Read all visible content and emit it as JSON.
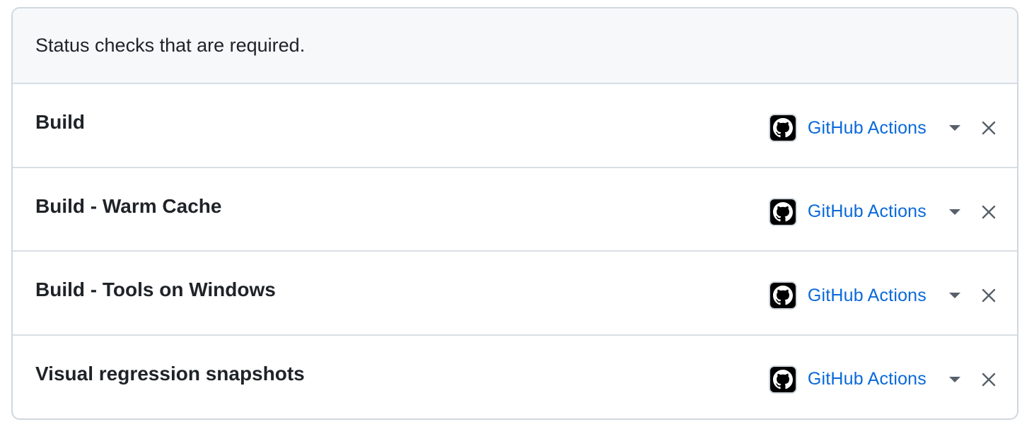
{
  "header": {
    "text": "Status checks that are required."
  },
  "checks": [
    {
      "name": "Build",
      "app_name": "GitHub Actions"
    },
    {
      "name": "Build - Warm Cache",
      "app_name": "GitHub Actions"
    },
    {
      "name": "Build - Tools on Windows",
      "app_name": "GitHub Actions"
    },
    {
      "name": "Visual regression snapshots",
      "app_name": "GitHub Actions"
    }
  ],
  "icons": {
    "app_avatar": "github-octocat-icon",
    "dropdown": "triangle-down-icon",
    "remove": "x-icon"
  },
  "colors": {
    "link": "#0969da",
    "header_bg": "#f6f8fa",
    "border": "#d0d7de",
    "text": "#1f2328",
    "icon": "#57606a"
  }
}
